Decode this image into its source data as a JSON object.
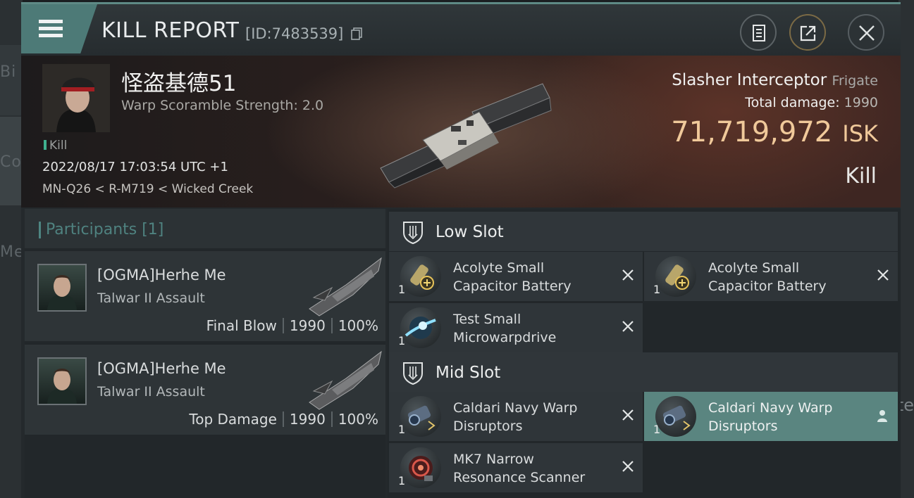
{
  "header": {
    "title": "KILL REPORT",
    "report_id": "[ID:7483539]",
    "icons": [
      "menu-icon",
      "copy-icon",
      "notes-icon",
      "share-icon",
      "close-icon"
    ]
  },
  "victim": {
    "name": "怪盗基德51",
    "scramble": "Warp Scoramble Strength: 2.0",
    "kill_tag": "Kill",
    "datetime": "2022/08/17 17:03:54 UTC +1",
    "location": "MN-Q26 < R-M719 < Wicked Creek",
    "ship_name": "Slasher Interceptor",
    "ship_class": "Frigate",
    "total_damage_label": "Total damage:",
    "total_damage": "1990",
    "isk_value": "71,719,972",
    "isk_unit": "ISK",
    "result": "Kill"
  },
  "participants": {
    "header": "Participants [1]",
    "rows": [
      {
        "name": "[OGMA]Herhe Me",
        "ship": "Talwar II Assault",
        "role": "Final Blow",
        "damage": "1990",
        "percent": "100%"
      },
      {
        "name": "[OGMA]Herhe Me",
        "ship": "Talwar II Assault",
        "role": "Top Damage",
        "damage": "1990",
        "percent": "100%"
      }
    ]
  },
  "fitting": {
    "low_slot": {
      "label": "Low Slot",
      "modules": [
        {
          "qty": "1",
          "name_line1": "Acolyte Small",
          "name_line2": "Capacitor Battery"
        },
        {
          "qty": "1",
          "name_line1": "Acolyte Small",
          "name_line2": "Capacitor Battery"
        },
        {
          "qty": "1",
          "name_line1": "Test Small",
          "name_line2": "Microwarpdrive"
        }
      ]
    },
    "mid_slot": {
      "label": "Mid Slot",
      "modules": [
        {
          "qty": "1",
          "name_line1": "Caldari Navy Warp",
          "name_line2": "Disruptors"
        },
        {
          "qty": "1",
          "name_line1": "Caldari Navy Warp",
          "name_line2": "Disruptors",
          "selected": true
        },
        {
          "qty": "1",
          "name_line1": "MK7 Narrow",
          "name_line2": "Resonance Scanner"
        }
      ]
    }
  },
  "colors": {
    "accent_teal": "#4d7a77",
    "isk_gold": "#f0c99a",
    "selected_row": "#5a8580"
  }
}
